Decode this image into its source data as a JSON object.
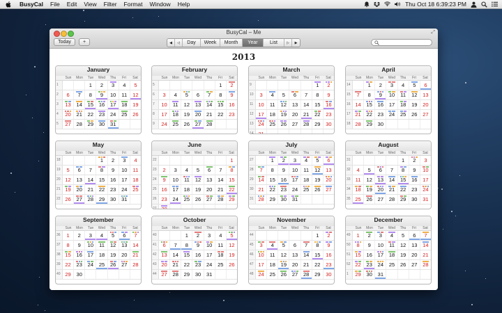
{
  "menubar": {
    "apple": "",
    "items": [
      "BusyCal",
      "File",
      "Edit",
      "View",
      "Filter",
      "Format",
      "Window",
      "Help"
    ],
    "clock": "Thu Oct 18  6:39:23 PM"
  },
  "window": {
    "title": "BusyCal – Me",
    "today_label": "Today",
    "add_label": "+",
    "nav_first": "◀",
    "nav_prev": "◁",
    "views": [
      "Day",
      "Week",
      "Month",
      "Year",
      "List"
    ],
    "selected_view": "Year",
    "nav_next": "▷",
    "nav_last": "▶",
    "search_placeholder": "",
    "year": "2013"
  },
  "weekday_labels": [
    "Sun",
    "Mon",
    "Tue",
    "Wed",
    "Thu",
    "Fri",
    "Sat"
  ],
  "months": [
    {
      "name": "January",
      "weeks": [
        "1",
        "2",
        "3",
        "4",
        "5"
      ],
      "days": [
        [
          "",
          "",
          "1",
          "2",
          "3",
          "4",
          "5"
        ],
        [
          "6",
          "7",
          "8",
          "9",
          "10",
          "11",
          "12"
        ],
        [
          "13",
          "14",
          "15",
          "16",
          "17",
          "18",
          "19"
        ],
        [
          "20",
          "21",
          "22",
          "23",
          "24",
          "25",
          "26"
        ],
        [
          "27",
          "28",
          "29",
          "30",
          "31",
          "",
          ""
        ]
      ]
    },
    {
      "name": "February",
      "weeks": [
        "5",
        "6",
        "7",
        "8",
        "9"
      ],
      "days": [
        [
          "",
          "",
          "",
          "",
          "",
          "1",
          "2"
        ],
        [
          "3",
          "4",
          "5",
          "6",
          "7",
          "8",
          "9"
        ],
        [
          "10",
          "11",
          "12",
          "13",
          "14",
          "15",
          "16"
        ],
        [
          "17",
          "18",
          "19",
          "20",
          "21",
          "22",
          "23"
        ],
        [
          "24",
          "25",
          "26",
          "27",
          "28",
          "",
          ""
        ]
      ]
    },
    {
      "name": "March",
      "weeks": [
        "9",
        "10",
        "11",
        "12",
        "13",
        "14"
      ],
      "days": [
        [
          "",
          "",
          "",
          "",
          "",
          "1",
          "2"
        ],
        [
          "3",
          "4",
          "5",
          "6",
          "7",
          "8",
          "9"
        ],
        [
          "10",
          "11",
          "12",
          "13",
          "14",
          "15",
          "16"
        ],
        [
          "17",
          "18",
          "19",
          "20",
          "21",
          "22",
          "23"
        ],
        [
          "24",
          "25",
          "26",
          "27",
          "28",
          "29",
          "30"
        ],
        [
          "31",
          "",
          "",
          "",
          "",
          "",
          ""
        ]
      ]
    },
    {
      "name": "April",
      "weeks": [
        "14",
        "15",
        "16",
        "17",
        "18"
      ],
      "days": [
        [
          "",
          "1",
          "2",
          "3",
          "4",
          "5",
          "6"
        ],
        [
          "7",
          "8",
          "9",
          "10",
          "11",
          "12",
          "13"
        ],
        [
          "14",
          "15",
          "16",
          "17",
          "18",
          "19",
          "20"
        ],
        [
          "21",
          "22",
          "23",
          "24",
          "25",
          "26",
          "27"
        ],
        [
          "28",
          "29",
          "30",
          "",
          "",
          "",
          ""
        ]
      ]
    },
    {
      "name": "May",
      "weeks": [
        "18",
        "19",
        "20",
        "21",
        "22"
      ],
      "days": [
        [
          "",
          "",
          "",
          "1",
          "2",
          "3",
          "4"
        ],
        [
          "5",
          "6",
          "7",
          "8",
          "9",
          "10",
          "11"
        ],
        [
          "12",
          "13",
          "14",
          "15",
          "16",
          "17",
          "18"
        ],
        [
          "19",
          "20",
          "21",
          "22",
          "23",
          "24",
          "25"
        ],
        [
          "26",
          "27",
          "28",
          "29",
          "30",
          "31",
          ""
        ]
      ]
    },
    {
      "name": "June",
      "weeks": [
        "22",
        "23",
        "24",
        "25",
        "26",
        "27"
      ],
      "days": [
        [
          "",
          "",
          "",
          "",
          "",
          "",
          "1"
        ],
        [
          "2",
          "3",
          "4",
          "5",
          "6",
          "7",
          "8"
        ],
        [
          "9",
          "10",
          "11",
          "12",
          "13",
          "14",
          "15"
        ],
        [
          "16",
          "17",
          "18",
          "19",
          "20",
          "21",
          "22"
        ],
        [
          "23",
          "24",
          "25",
          "26",
          "27",
          "28",
          "29"
        ],
        [
          "30",
          "",
          "",
          "",
          "",
          "",
          ""
        ]
      ]
    },
    {
      "name": "July",
      "weeks": [
        "27",
        "28",
        "29",
        "30",
        "31"
      ],
      "days": [
        [
          "",
          "1",
          "2",
          "3",
          "4",
          "5",
          "6"
        ],
        [
          "7",
          "8",
          "9",
          "10",
          "11",
          "12",
          "13"
        ],
        [
          "14",
          "15",
          "16",
          "17",
          "18",
          "19",
          "20"
        ],
        [
          "21",
          "22",
          "23",
          "24",
          "25",
          "26",
          "27"
        ],
        [
          "28",
          "29",
          "30",
          "31",
          "",
          "",
          ""
        ]
      ]
    },
    {
      "name": "August",
      "weeks": [
        "31",
        "32",
        "33",
        "34",
        "35"
      ],
      "days": [
        [
          "",
          "",
          "",
          "",
          "1",
          "2",
          "3"
        ],
        [
          "4",
          "5",
          "6",
          "7",
          "8",
          "9",
          "10"
        ],
        [
          "11",
          "12",
          "13",
          "14",
          "15",
          "16",
          "17"
        ],
        [
          "18",
          "19",
          "20",
          "21",
          "22",
          "23",
          "24"
        ],
        [
          "25",
          "26",
          "27",
          "28",
          "29",
          "30",
          "31"
        ]
      ]
    },
    {
      "name": "September",
      "weeks": [
        "36",
        "37",
        "38",
        "39",
        "40"
      ],
      "days": [
        [
          "1",
          "2",
          "3",
          "4",
          "5",
          "6",
          "7"
        ],
        [
          "8",
          "9",
          "10",
          "11",
          "12",
          "13",
          "14"
        ],
        [
          "15",
          "16",
          "17",
          "18",
          "19",
          "20",
          "21"
        ],
        [
          "22",
          "23",
          "24",
          "25",
          "26",
          "27",
          "28"
        ],
        [
          "29",
          "30",
          "",
          "",
          "",
          "",
          ""
        ]
      ]
    },
    {
      "name": "October",
      "weeks": [
        "40",
        "41",
        "42",
        "43",
        "44"
      ],
      "days": [
        [
          "",
          "",
          "1",
          "2",
          "3",
          "4",
          "5"
        ],
        [
          "6",
          "7",
          "8",
          "9",
          "10",
          "11",
          "12"
        ],
        [
          "13",
          "14",
          "15",
          "16",
          "17",
          "18",
          "19"
        ],
        [
          "20",
          "21",
          "22",
          "23",
          "24",
          "25",
          "26"
        ],
        [
          "27",
          "28",
          "29",
          "30",
          "31",
          "",
          ""
        ]
      ]
    },
    {
      "name": "November",
      "weeks": [
        "44",
        "45",
        "46",
        "47",
        "48"
      ],
      "days": [
        [
          "",
          "",
          "",
          "",
          "",
          "1",
          "2"
        ],
        [
          "3",
          "4",
          "5",
          "6",
          "7",
          "8",
          "9"
        ],
        [
          "10",
          "11",
          "12",
          "13",
          "14",
          "15",
          "16"
        ],
        [
          "17",
          "18",
          "19",
          "20",
          "21",
          "22",
          "23"
        ],
        [
          "24",
          "25",
          "26",
          "27",
          "28",
          "29",
          "30"
        ]
      ]
    },
    {
      "name": "December",
      "weeks": [
        "49",
        "50",
        "51",
        "52",
        "1"
      ],
      "days": [
        [
          "1",
          "2",
          "3",
          "4",
          "5",
          "6",
          "7"
        ],
        [
          "8",
          "9",
          "10",
          "11",
          "12",
          "13",
          "14"
        ],
        [
          "15",
          "16",
          "17",
          "18",
          "19",
          "20",
          "21"
        ],
        [
          "22",
          "23",
          "24",
          "25",
          "26",
          "27",
          "28"
        ],
        [
          "29",
          "30",
          "31",
          "",
          "",
          "",
          ""
        ]
      ]
    }
  ],
  "colors": {
    "accent": "#6e6e6e",
    "weekend": "#d32020",
    "event_green": "#7cc46c",
    "event_blue": "#7fa6e6",
    "event_purple": "#b38bf0",
    "event_red": "#e47a7a",
    "event_orange": "#f0b04a"
  }
}
